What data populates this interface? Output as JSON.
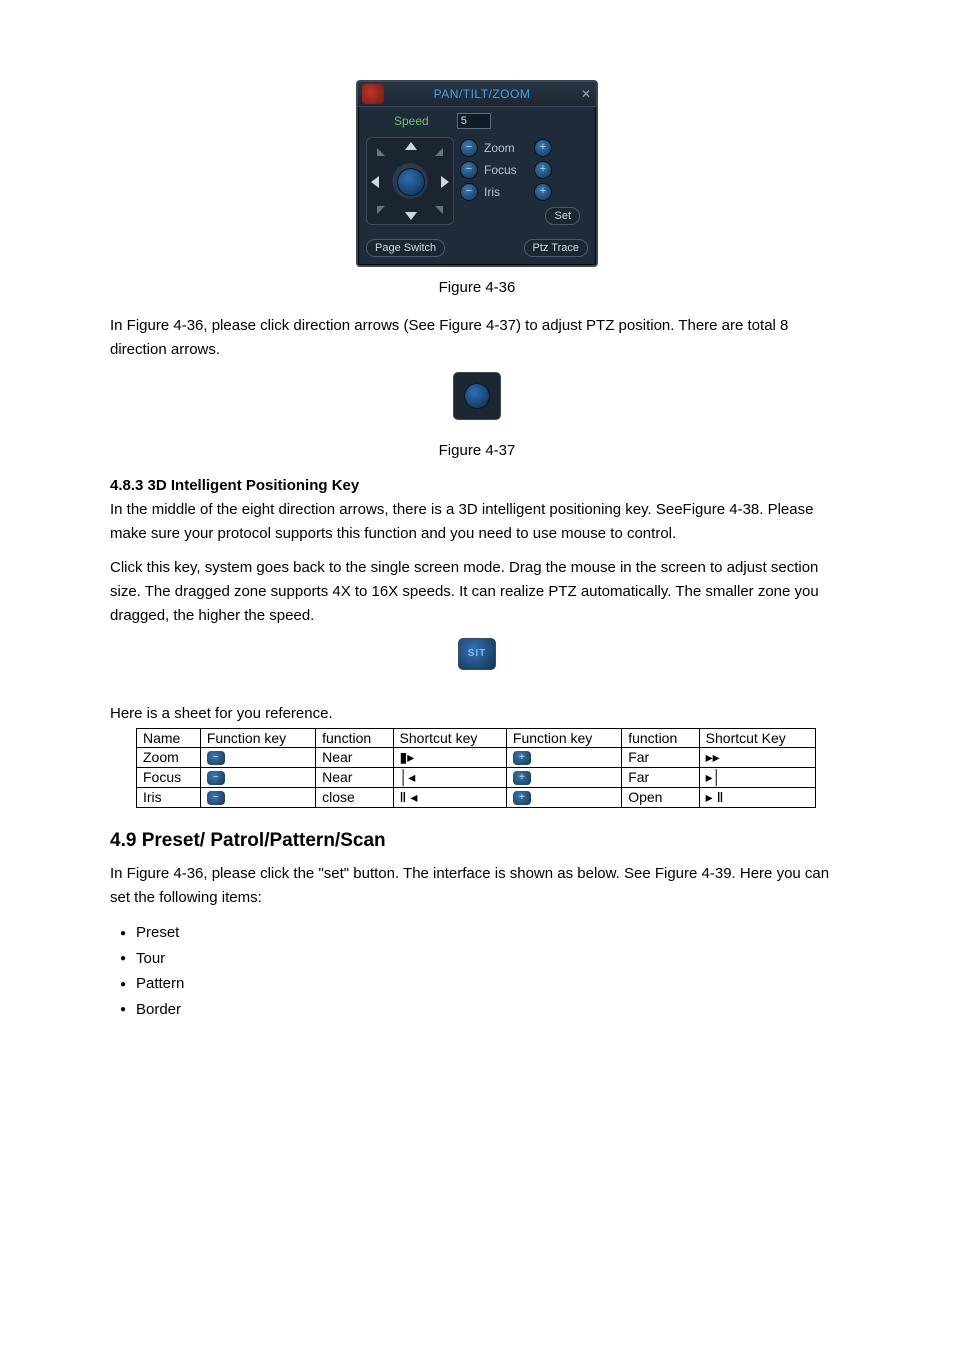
{
  "ptz_panel": {
    "title": "PAN/TILT/ZOOM",
    "speed_label": "Speed",
    "speed_value": "5",
    "rows": {
      "zoom": "Zoom",
      "focus": "Focus",
      "iris": "Iris"
    },
    "set_btn": "Set",
    "page_switch_btn": "Page Switch",
    "ptz_trace_btn": "Ptz Trace"
  },
  "fig1_caption": "Figure 4-36",
  "para1": "In Figure 4-36, please click direction arrows (See Figure 4-37) to adjust PTZ position. There are total 8 direction arrows.",
  "fig2_caption": "Figure 4-37",
  "section483": {
    "heading": "4.8.3 3D Intelligent Positioning Key",
    "p1": "In the middle of the eight direction arrows, there is a 3D intelligent positioning key. SeeFigure 4-38. Please make sure your protocol supports this function and you need to use mouse to control.",
    "p2": "Click this key, system goes back to the single screen mode. Drag the mouse in the screen to adjust section size.  The dragged zone supports 4X to 16X speeds. It can realize PTZ automatically. The smaller zone you dragged, the higher the speed."
  },
  "sit_label": "SIT",
  "sheet_intro": "Here is a sheet for you reference.",
  "table": {
    "headers": [
      "Name",
      "Function key",
      "function",
      "Shortcut key",
      "Function key",
      "function",
      "Shortcut Key"
    ],
    "rows": [
      {
        "name": "Zoom",
        "fk1": "−",
        "fn1": "Near",
        "sk1": "▮▸",
        "fk2": "+",
        "fn2": "Far",
        "sk2": "▸▸"
      },
      {
        "name": "Focus",
        "fk1": "−",
        "fn1": "Near",
        "sk1": "│◂",
        "fk2": "+",
        "fn2": "Far",
        "sk2": "▸│"
      },
      {
        "name": "Iris",
        "fk1": "−",
        "fn1": "close",
        "sk1": "Ⅱ ◂",
        "fk2": "+",
        "fn2": "Open",
        "sk2": "▸ Ⅱ"
      }
    ]
  },
  "section49": {
    "heading": "4.9  Preset/ Patrol/Pattern/Scan",
    "intro": "In Figure 4-36, please click the \"set\" button. The interface is shown as below. See Figure 4-39. Here you can set the following items:",
    "items": [
      "Preset",
      "Tour",
      "Pattern",
      "Border"
    ]
  }
}
